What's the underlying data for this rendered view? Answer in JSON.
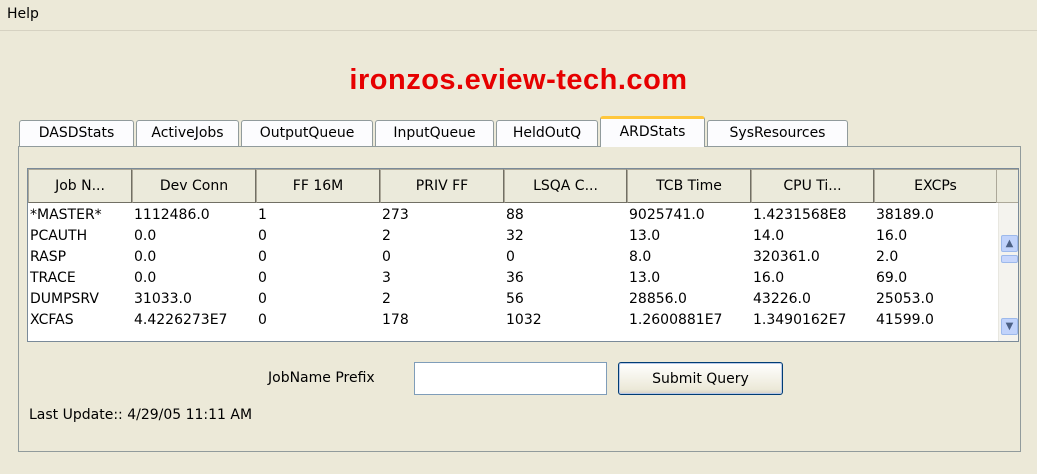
{
  "menu": {
    "help_label": "Help"
  },
  "host_title": "ironzos.eview-tech.com",
  "tabs": [
    {
      "label": "DASDStats"
    },
    {
      "label": "ActiveJobs"
    },
    {
      "label": "OutputQueue"
    },
    {
      "label": "InputQueue"
    },
    {
      "label": "HeldOutQ"
    },
    {
      "label": "ARDStats",
      "active": true
    },
    {
      "label": "SysResources"
    }
  ],
  "table": {
    "columns": [
      "Job N...",
      "Dev Conn",
      "FF 16M",
      "PRIV FF",
      "LSQA C...",
      "TCB Time",
      "CPU Ti...",
      "EXCPs"
    ],
    "rows": [
      [
        "*MASTER*",
        "1112486.0",
        "1",
        "273",
        "88",
        "9025741.0",
        "1.4231568E8",
        "38189.0"
      ],
      [
        "PCAUTH",
        "0.0",
        "0",
        "2",
        "32",
        "13.0",
        "14.0",
        "16.0"
      ],
      [
        "RASP",
        "0.0",
        "0",
        "0",
        "0",
        "8.0",
        "320361.0",
        "2.0"
      ],
      [
        "TRACE",
        "0.0",
        "0",
        "3",
        "36",
        "13.0",
        "16.0",
        "69.0"
      ],
      [
        "DUMPSRV",
        "31033.0",
        "0",
        "2",
        "56",
        "28856.0",
        "43226.0",
        "25053.0"
      ],
      [
        "XCFAS",
        "4.4226273E7",
        "0",
        "178",
        "1032",
        "1.2600881E7",
        "1.3490162E7",
        "41599.0"
      ]
    ]
  },
  "scroll": {
    "up_icon": "chevron-up-icon",
    "down_icon": "chevron-down-icon"
  },
  "query": {
    "label": "JobName Prefix",
    "input_value": "",
    "submit_label": "Submit Query"
  },
  "status": {
    "last_update": "Last Update:: 4/29/05 11:11 AM"
  },
  "colors": {
    "title": "#e60000",
    "active_tab_accent": "#ffc73c",
    "background": "#ece9d8"
  }
}
